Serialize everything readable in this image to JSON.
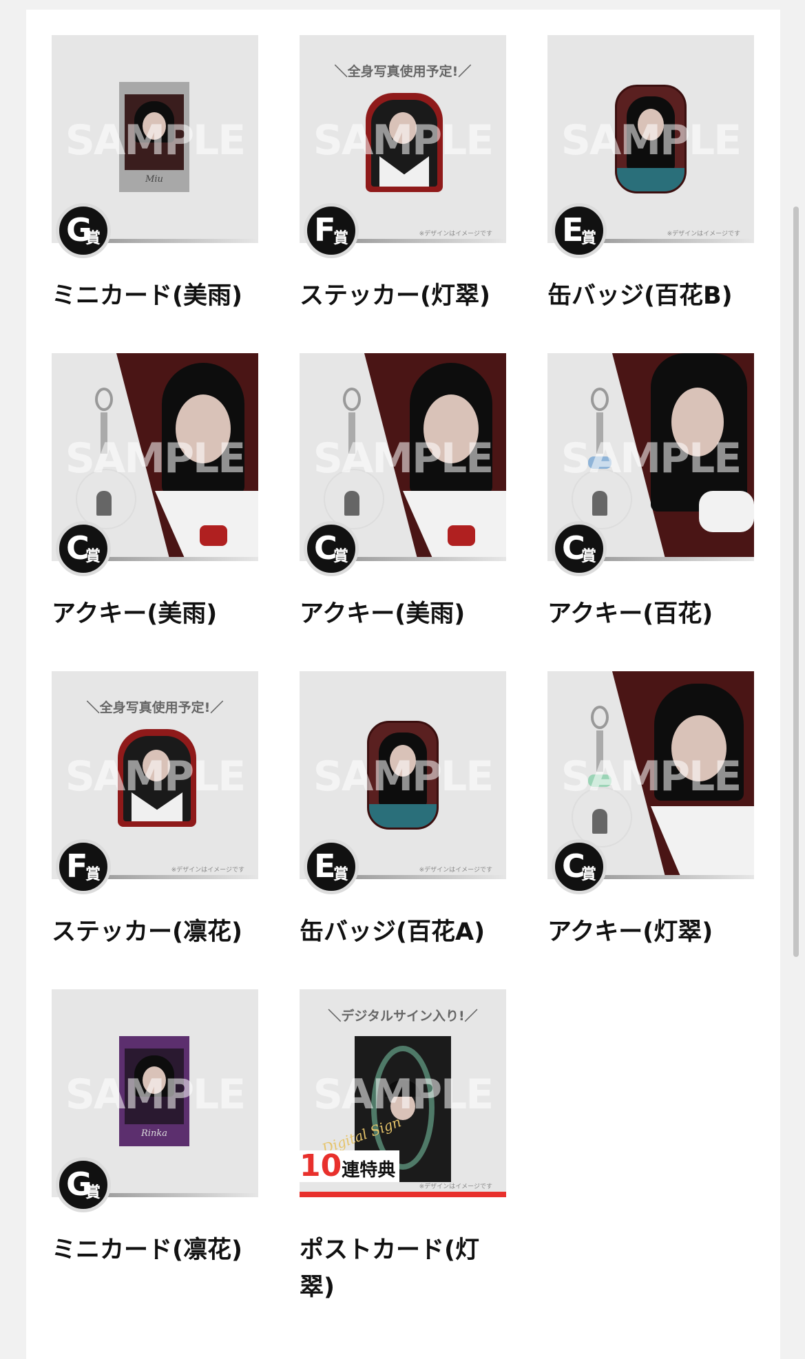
{
  "watermark": "SAMPLE",
  "note": "※デザインはイメージです",
  "prize_suffix": "賞",
  "items": [
    {
      "grade": "G",
      "name": "ミニカード(美雨)",
      "caption": "",
      "card_label": "Miu"
    },
    {
      "grade": "F",
      "name": "ステッカー(灯翠)",
      "caption": "＼全身写真使用予定!／"
    },
    {
      "grade": "E",
      "name": "缶バッジ(百花B)",
      "caption": ""
    },
    {
      "grade": "C",
      "name": "アクキー(美雨)",
      "caption": ""
    },
    {
      "grade": "C",
      "name": "アクキー(美雨)",
      "caption": ""
    },
    {
      "grade": "C",
      "name": "アクキー(百花)",
      "caption": ""
    },
    {
      "grade": "F",
      "name": "ステッカー(凛花)",
      "caption": "＼全身写真使用予定!／"
    },
    {
      "grade": "E",
      "name": "缶バッジ(百花A)",
      "caption": ""
    },
    {
      "grade": "C",
      "name": "アクキー(灯翠)",
      "caption": ""
    },
    {
      "grade": "G",
      "name": "ミニカード(凛花)",
      "caption": "",
      "card_label": "Rinka"
    },
    {
      "grade": "",
      "name": "ポストカード(灯翠)",
      "caption": "＼デジタルサイン入り!／",
      "bonus_number": "10",
      "bonus_label": "連特典",
      "sign_text": "Digital Sign"
    }
  ],
  "colors": {
    "badge": "#111111",
    "bonus_red": "#e8302c",
    "page_bg": "#f1f1f1"
  }
}
